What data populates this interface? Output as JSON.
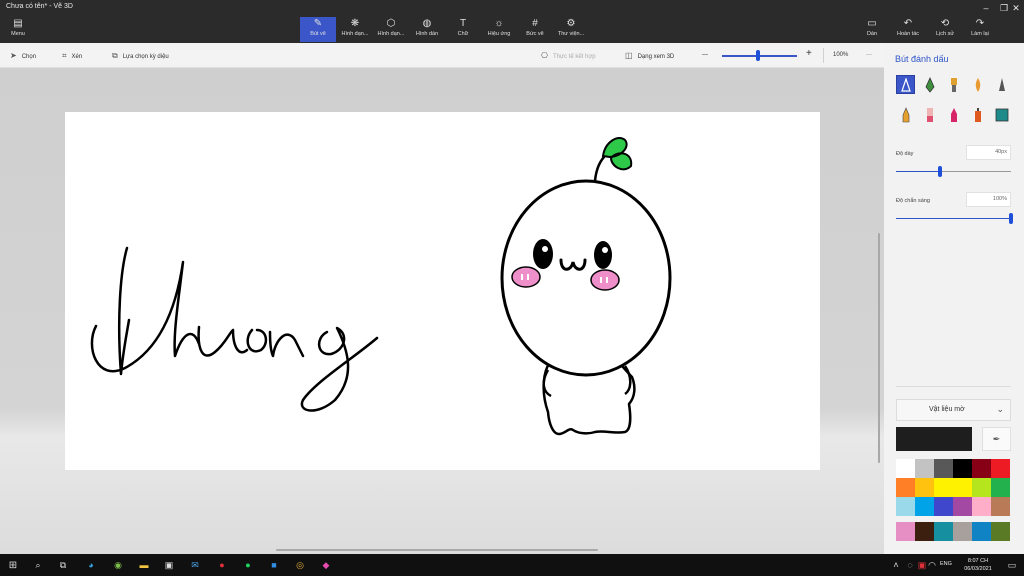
{
  "window": {
    "title": "Chưa có tên* - Vẽ 3D",
    "minimize": "–",
    "restore": "❐",
    "close": "✕"
  },
  "ribbon": {
    "menu": {
      "label": "Menu",
      "icon": "folder-icon"
    },
    "tabs": [
      {
        "label": "Bút vẽ",
        "icon": "brush-icon",
        "active": true
      },
      {
        "label": "Hình dạn...",
        "icon": "shapes-3d-icon"
      },
      {
        "label": "Hình dạn...",
        "icon": "cube-icon"
      },
      {
        "label": "Hình dán",
        "icon": "sticker-icon"
      },
      {
        "label": "Chữ",
        "icon": "text-icon"
      },
      {
        "label": "Hiệu ứng",
        "icon": "sun-icon"
      },
      {
        "label": "Bức vẽ",
        "icon": "canvas-icon"
      },
      {
        "label": "Thư viện...",
        "icon": "library-icon"
      }
    ],
    "right": [
      {
        "label": "Dán",
        "icon": "paste-icon"
      },
      {
        "label": "Hoàn tác",
        "icon": "undo-icon"
      },
      {
        "label": "Lịch sử",
        "icon": "history-icon"
      },
      {
        "label": "Làm lại",
        "icon": "redo-icon"
      }
    ]
  },
  "toolbar": {
    "select": "Chọn",
    "crop": "Xén",
    "magic_select": "Lựa chọn kỳ diệu",
    "mixed_reality": "Thực tế kết hợp",
    "view3d": "Dạng xem 3D",
    "zoom_minus": "—",
    "zoom_plus": "+",
    "zoom_value": "100%",
    "more": "···",
    "zoom_level": 0.48
  },
  "canvas": {
    "signature_text": "Hương",
    "colors": {
      "cheek": "#ee8fc9",
      "leaf": "#2fc94a",
      "ink": "#000000"
    }
  },
  "panel": {
    "title": "Bút đánh dấu",
    "thickness_label": "Độ dày",
    "thickness_value": "40px",
    "thickness_level": 0.38,
    "opacity_label": "Độ chắn sáng",
    "opacity_value": "100%",
    "opacity_level": 1.0,
    "material": "Vật liệu mờ",
    "current_color": "#1e1e1e",
    "swatches": [
      "#ffffff",
      "#c3c3c3",
      "#585858",
      "#000000",
      "#880015",
      "#ed1c24",
      "#ff7f27",
      "#ffc20e",
      "#fff200",
      "#fff200",
      "#b5e61d",
      "#22b14c",
      "#99d9ea",
      "#00a2e8",
      "#3f48cc",
      "#a349a4",
      "#ffaec9",
      "#b97a57"
    ],
    "swatches_extra": [
      "#e58fc4",
      "#3d1f10",
      "#168fa0",
      "#a8a09c",
      "#0f83c4",
      "#5a7a26"
    ]
  },
  "taskbar": {
    "time": "8:07 CH",
    "date": "06/03/2021",
    "lang": "ENG"
  }
}
